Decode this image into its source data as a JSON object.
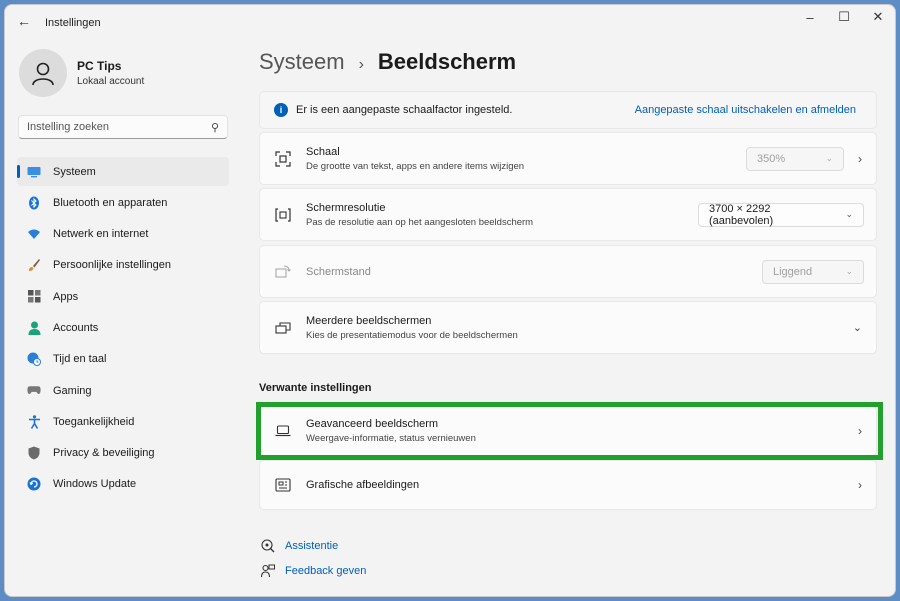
{
  "window": {
    "title": "Instellingen"
  },
  "profile": {
    "name": "PC Tips",
    "account_type": "Lokaal account"
  },
  "search": {
    "placeholder": "Instelling zoeken"
  },
  "sidebar": {
    "items": [
      {
        "label": "Systeem",
        "icon": "monitor-icon",
        "active": true
      },
      {
        "label": "Bluetooth en apparaten",
        "icon": "bluetooth-icon"
      },
      {
        "label": "Netwerk en internet",
        "icon": "wifi-icon"
      },
      {
        "label": "Persoonlijke instellingen",
        "icon": "brush-icon"
      },
      {
        "label": "Apps",
        "icon": "apps-icon"
      },
      {
        "label": "Accounts",
        "icon": "person-icon"
      },
      {
        "label": "Tijd en taal",
        "icon": "globe-clock-icon"
      },
      {
        "label": "Gaming",
        "icon": "gamepad-icon"
      },
      {
        "label": "Toegankelijkheid",
        "icon": "accessibility-icon"
      },
      {
        "label": "Privacy & beveiliging",
        "icon": "shield-icon"
      },
      {
        "label": "Windows Update",
        "icon": "update-icon"
      }
    ]
  },
  "breadcrumb": {
    "parent": "Systeem",
    "current": "Beeldscherm"
  },
  "banner": {
    "text": "Er is een aangepaste schaalfactor ingesteld.",
    "link": "Aangepaste schaal uitschakelen en afmelden"
  },
  "settings": {
    "schaal": {
      "title": "Schaal",
      "subtitle": "De grootte van tekst, apps en andere items wijzigen",
      "value": "350%"
    },
    "resolutie": {
      "title": "Schermresolutie",
      "subtitle": "Pas de resolutie aan op het aangesloten beeldscherm",
      "value": "3700 × 2292 (aanbevolen)"
    },
    "stand": {
      "title": "Schermstand",
      "value": "Liggend"
    },
    "meerdere": {
      "title": "Meerdere beeldschermen",
      "subtitle": "Kies de presentatiemodus voor de beeldschermen"
    }
  },
  "related": {
    "heading": "Verwante instellingen",
    "advanced": {
      "title": "Geavanceerd beeldscherm",
      "subtitle": "Weergave-informatie, status vernieuwen"
    },
    "graphics": {
      "title": "Grafische afbeeldingen"
    }
  },
  "footer": {
    "help": "Assistentie",
    "feedback": "Feedback geven"
  },
  "colors": {
    "accent": "#005fb8",
    "highlight": "#21a02e"
  }
}
